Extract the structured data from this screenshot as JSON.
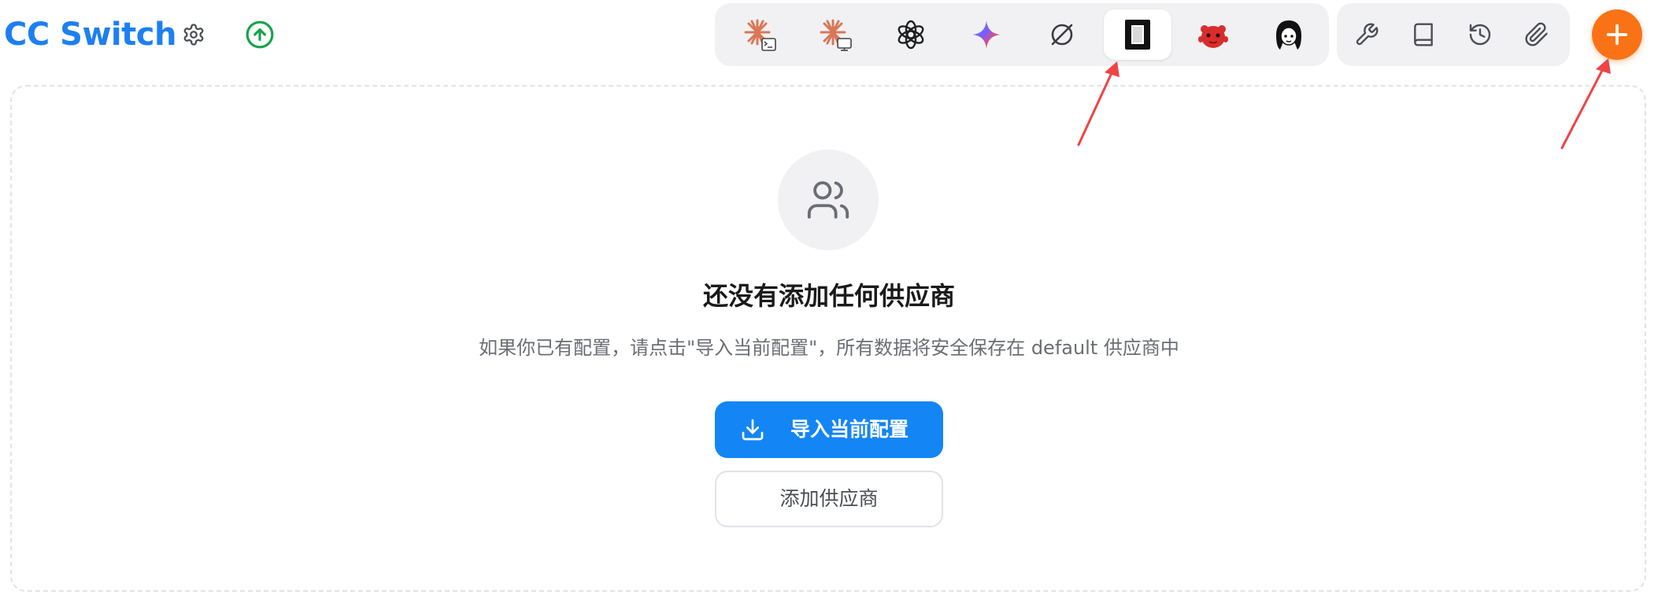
{
  "header": {
    "app_title": "CC Switch",
    "settings_icon": "gear-icon",
    "update_icon": "arrow-up-circle-icon",
    "update_color": "#16a34a"
  },
  "app_tabs": [
    {
      "id": "claude-code",
      "icon": "claude-terminal-icon",
      "active": false
    },
    {
      "id": "claude-desktop",
      "icon": "claude-desktop-icon",
      "active": false
    },
    {
      "id": "codex",
      "icon": "openai-icon",
      "active": false
    },
    {
      "id": "gemini",
      "icon": "gemini-sparkle-icon",
      "active": false
    },
    {
      "id": "opencode",
      "icon": "slashed-circle-icon",
      "active": false
    },
    {
      "id": "app-6",
      "icon": "black-square-icon",
      "active": true
    },
    {
      "id": "app-7",
      "icon": "red-creature-icon",
      "active": false
    },
    {
      "id": "app-8",
      "icon": "girl-avatar-icon",
      "active": false
    }
  ],
  "tools": [
    {
      "id": "tools",
      "icon": "wrench-icon"
    },
    {
      "id": "docs",
      "icon": "book-icon"
    },
    {
      "id": "history",
      "icon": "history-icon"
    },
    {
      "id": "attachments",
      "icon": "paperclip-icon"
    }
  ],
  "add_button": {
    "icon": "plus-icon",
    "color": "#f97316"
  },
  "empty_state": {
    "icon": "users-icon",
    "title": "还没有添加任何供应商",
    "description": "如果你已有配置，请点击\"导入当前配置\"，所有数据将安全保存在 default 供应商中",
    "import_button_label": "导入当前配置",
    "import_button_icon": "download-icon",
    "add_provider_button_label": "添加供应商"
  },
  "colors": {
    "brand_blue": "#1d7ff2",
    "primary_button": "#1485f5",
    "accent_orange": "#f97316",
    "annotation_red": "#ef4444",
    "panel_border": "#e2e3e7"
  }
}
